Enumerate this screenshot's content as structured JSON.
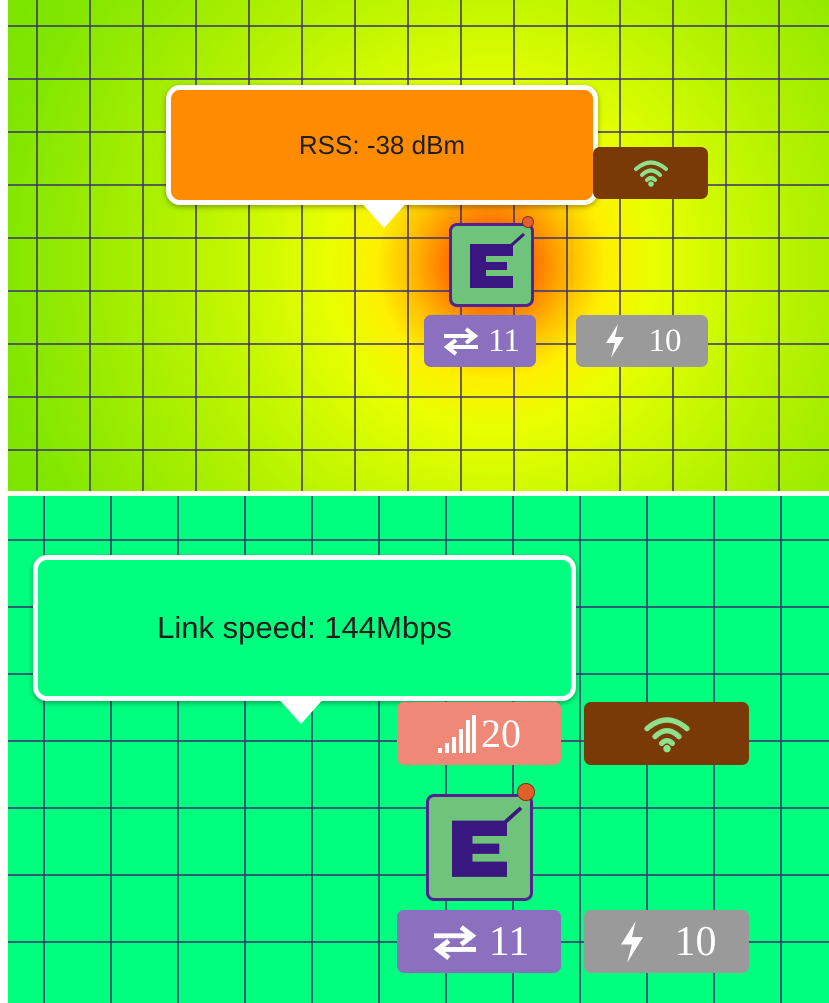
{
  "colors": {
    "heat_hot": "#ff2a00",
    "heat_mid": "#fff000",
    "heat_cool": "#6de000",
    "link_bg": "#00ff7f",
    "grid_line": "#3b2f6e",
    "rss_tooltip": "#ff8c00",
    "link_tooltip": "#00ff7f",
    "wifi_badge": "#7a3a08",
    "clients_badge": "#8a70bf",
    "power_badge": "#9a9a9a",
    "signal_badge": "#f08878",
    "ap_fill": "#6fc37a",
    "ap_border": "#4f2490"
  },
  "top_panel": {
    "tooltip": {
      "text": "RSS: -38 dBm"
    },
    "wifi_badge": {
      "icon": "wifi-icon"
    },
    "clients_badge": {
      "icon": "transfer-arrows-icon",
      "value": "11"
    },
    "power_badge": {
      "icon": "lightning-icon",
      "value": "10"
    },
    "access_point": {
      "icon": "extreme-logo-icon"
    }
  },
  "bottom_panel": {
    "tooltip": {
      "text": "Link speed: 144Mbps"
    },
    "signal_badge": {
      "icon": "signal-bars-icon",
      "value": "20"
    },
    "wifi_badge": {
      "icon": "wifi-icon"
    },
    "clients_badge": {
      "icon": "transfer-arrows-icon",
      "value": "11"
    },
    "power_badge": {
      "icon": "lightning-icon",
      "value": "10"
    },
    "access_point": {
      "icon": "extreme-logo-icon"
    }
  }
}
